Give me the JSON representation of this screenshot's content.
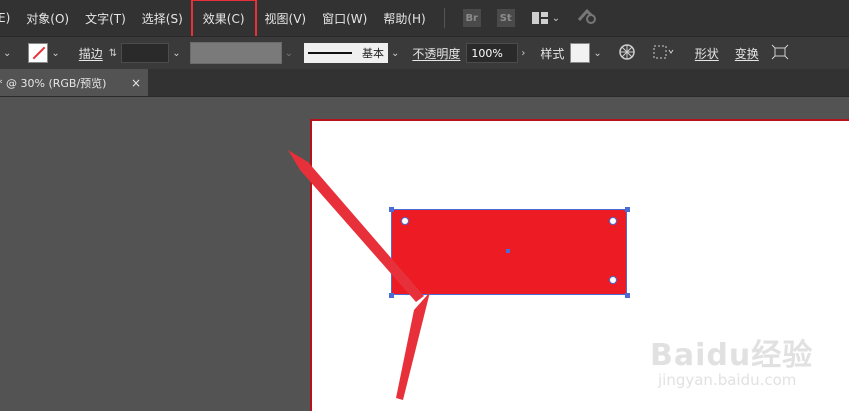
{
  "menubar": {
    "items": [
      "E)",
      "对象(O)",
      "文字(T)",
      "选择(S)",
      "效果(C)",
      "视图(V)",
      "窗口(W)",
      "帮助(H)"
    ],
    "app_icons": [
      "Br",
      "St"
    ]
  },
  "controlbar": {
    "stroke_label": "描边",
    "brush_label": "基本",
    "opacity_label": "不透明度",
    "opacity_value": "100%",
    "style_label": "样式",
    "shape_label": "形状",
    "transform_label": "变换"
  },
  "tabbar": {
    "doc_title": "* @ 30% (RGB/预览)",
    "close": "×"
  },
  "canvas": {
    "rect_fill": "#ed1c24",
    "artboard_border": "#b5121b",
    "selection_color": "#4a6cd4",
    "arrow_color": "#e8303a"
  },
  "watermark": {
    "brand": "Baidu经验",
    "url": "jingyan.baidu.com"
  }
}
